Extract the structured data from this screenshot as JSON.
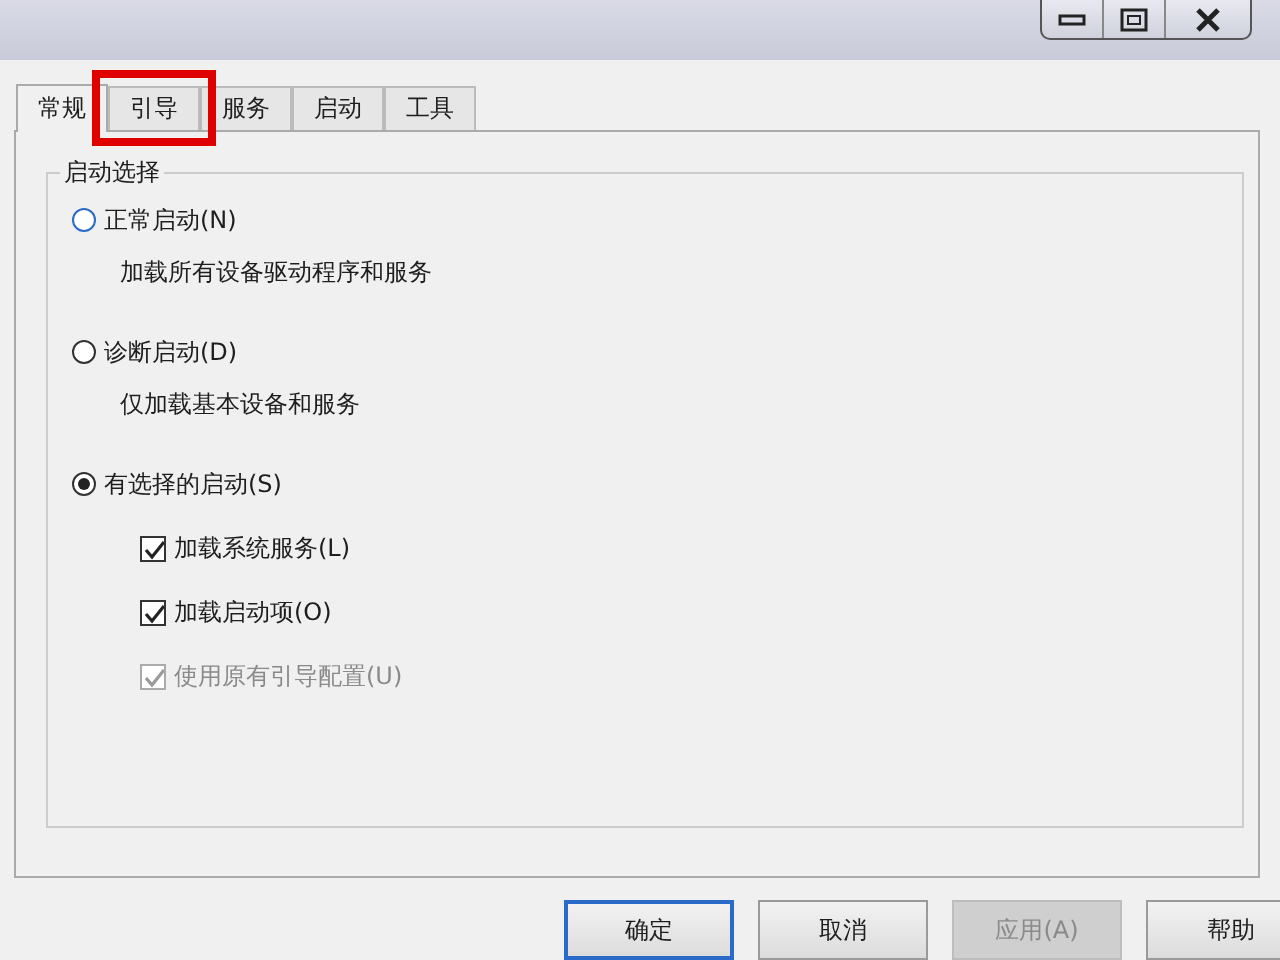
{
  "tabs": [
    {
      "label": "常规",
      "selected": true
    },
    {
      "label": "引导",
      "selected": false,
      "highlighted": true
    },
    {
      "label": "服务",
      "selected": false
    },
    {
      "label": "启动",
      "selected": false
    },
    {
      "label": "工具",
      "selected": false
    }
  ],
  "group": {
    "title": "启动选择",
    "modes": [
      {
        "label": "正常启动(N)",
        "description": "加载所有设备驱动程序和服务",
        "selected": false
      },
      {
        "label": "诊断启动(D)",
        "description": "仅加载基本设备和服务",
        "selected": false
      },
      {
        "label": "有选择的启动(S)",
        "selected": true,
        "options": [
          {
            "label": "加载系统服务(L)",
            "checked": true,
            "disabled": false
          },
          {
            "label": "加载启动项(O)",
            "checked": true,
            "disabled": false
          },
          {
            "label": "使用原有引导配置(U)",
            "checked": true,
            "disabled": true
          }
        ]
      }
    ]
  },
  "buttons": [
    {
      "label": "确定",
      "default": true,
      "disabled": false
    },
    {
      "label": "取消",
      "default": false,
      "disabled": false
    },
    {
      "label": "应用(A)",
      "default": false,
      "disabled": true
    },
    {
      "label": "帮助",
      "default": false,
      "disabled": false
    }
  ]
}
